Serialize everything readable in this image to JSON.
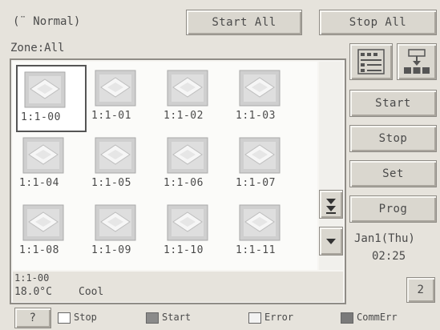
{
  "header": {
    "mode_label": "(¨ Normal)",
    "start_all_label": "Start All",
    "stop_all_label": "Stop All"
  },
  "zone_label": "Zone:All",
  "units": [
    {
      "label": "1:1-00",
      "selected": true
    },
    {
      "label": "1:1-01"
    },
    {
      "label": "1:1-02"
    },
    {
      "label": "1:1-03"
    },
    {
      "label": "1:1-04"
    },
    {
      "label": "1:1-05"
    },
    {
      "label": "1:1-06"
    },
    {
      "label": "1:1-07"
    },
    {
      "label": "1:1-08"
    },
    {
      "label": "1:1-09"
    },
    {
      "label": "1:1-10"
    },
    {
      "label": "1:1-11"
    }
  ],
  "detail": {
    "unit": "1:1-00",
    "temperature": "18.0°C",
    "mode": "Cool"
  },
  "side_buttons": {
    "start": "Start",
    "stop": "Stop",
    "set": "Set",
    "prog": "Prog"
  },
  "clock": {
    "date": "Jan1(Thu)",
    "time": "02:25"
  },
  "page_button": "2",
  "legend": {
    "help": "?",
    "stop": "Stop",
    "start": "Start",
    "error": "Error",
    "comm_err": "CommErr"
  },
  "icons": {
    "list_view": "list-view-icon",
    "group_view": "group-view-icon",
    "page_down": "double-down-arrow-icon",
    "down": "down-arrow-icon"
  },
  "colors": {
    "background": "#e6e3dc",
    "stop_swatch": "#ffffff",
    "start_swatch": "#8a8a8a",
    "error_swatch": "#f3f3f3",
    "comm_err_swatch": "#7a7a7a"
  }
}
